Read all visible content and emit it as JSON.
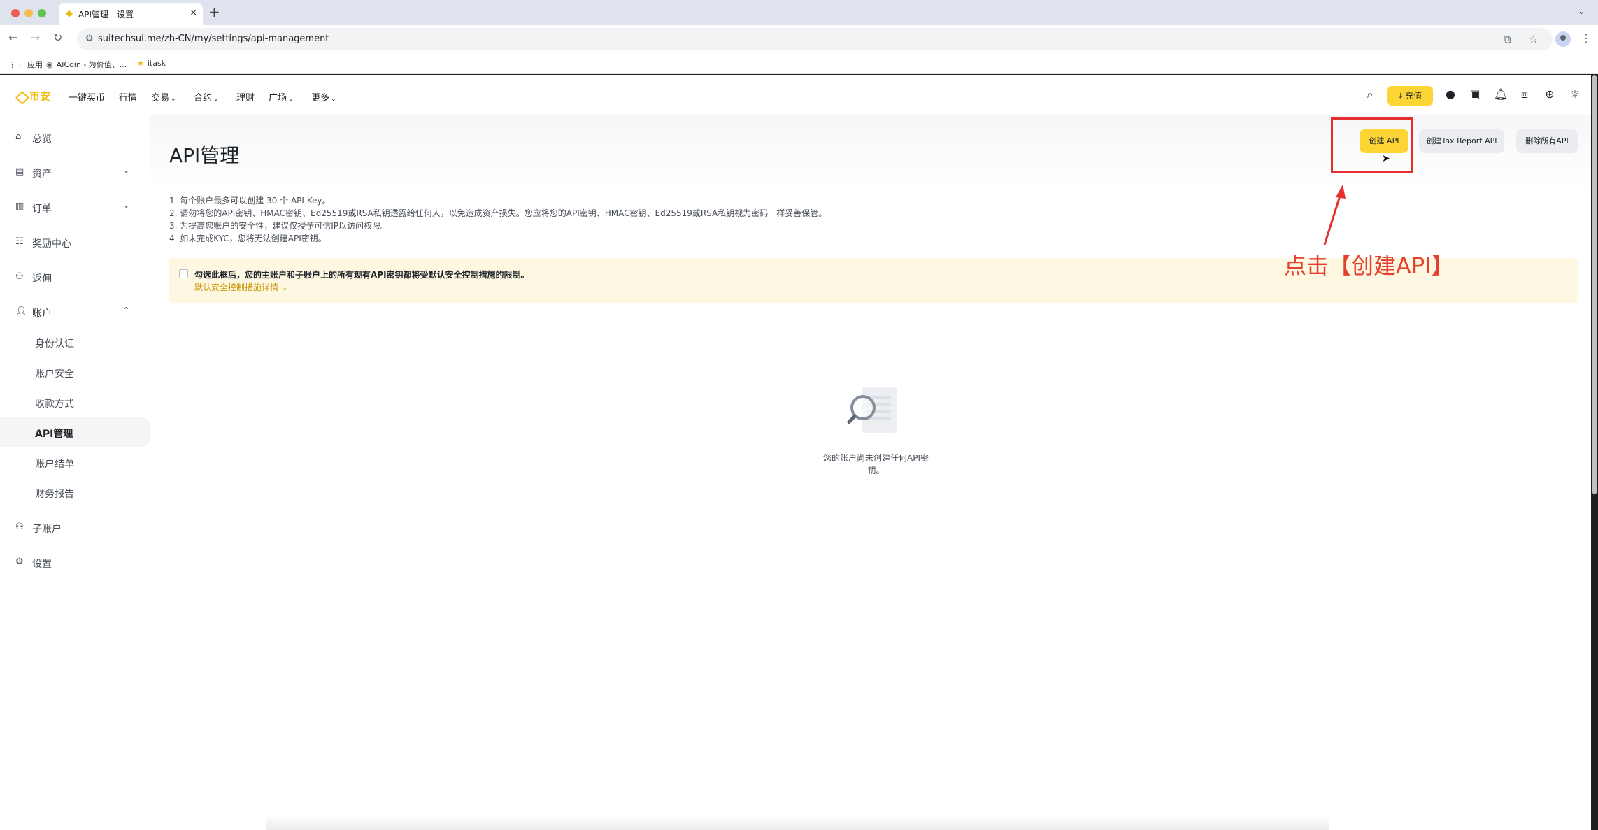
{
  "browser": {
    "tab_title": "API管理 - 设置",
    "tab_close": "×",
    "new_tab": "+",
    "tab_menu": "⌄",
    "url": "suitechsui.me/zh-CN/my/settings/api-management",
    "bookmarks": [
      {
        "label": "应用",
        "icon": "apps-grid-icon"
      },
      {
        "label": "AICoin - 为价值、...",
        "icon": "aicoin-icon"
      },
      {
        "label": "itask",
        "icon": "star-icon"
      }
    ]
  },
  "topnav": {
    "logo": "币安",
    "items": [
      {
        "label": "一键买币"
      },
      {
        "label": "行情"
      },
      {
        "label": "交易",
        "caret": true
      },
      {
        "label": "合约",
        "caret": true
      },
      {
        "label": "理财"
      },
      {
        "label": "广场",
        "caret": true
      },
      {
        "label": "更多",
        "caret": true
      }
    ],
    "deposit": "充值",
    "colors": {
      "brand": "#f0b90b",
      "button": "#fcd535"
    }
  },
  "sidebar": {
    "items": [
      {
        "label": "总览",
        "icon": "home-icon"
      },
      {
        "label": "资产",
        "icon": "wallet-icon",
        "expand": "down"
      },
      {
        "label": "订单",
        "icon": "orders-icon",
        "expand": "down"
      },
      {
        "label": "奖励中心",
        "icon": "rewards-icon"
      },
      {
        "label": "返佣",
        "icon": "referral-icon"
      },
      {
        "label": "账户",
        "icon": "user-icon",
        "expand": "up",
        "active_parent": true
      }
    ],
    "sub_items": [
      {
        "label": "身份认证"
      },
      {
        "label": "账户安全"
      },
      {
        "label": "收款方式"
      },
      {
        "label": "API管理",
        "active": true
      },
      {
        "label": "账户结单"
      },
      {
        "label": "财务报告"
      }
    ],
    "bottom_items": [
      {
        "label": "子账户",
        "icon": "sub-account-icon"
      },
      {
        "label": "设置",
        "icon": "gear-icon"
      }
    ]
  },
  "main": {
    "title": "API管理",
    "buttons": {
      "create_api": "创建 API",
      "create_tax_api": "创建Tax Report API",
      "delete_all": "删除所有API"
    },
    "notes": [
      "1. 每个账户最多可以创建 30 个 API Key。",
      "2. 请勿将您的API密钥、HMAC密钥、Ed25519或RSA私钥透露给任何人，以免造成资产损失。您应将您的API密钥、HMAC密钥、Ed25519或RSA私钥视为密码一样妥善保管。",
      "3. 为提高您账户的安全性，建议仅授予可信IP以访问权限。",
      "4. 如未完成KYC，您将无法创建API密钥。"
    ],
    "banner": {
      "text": "勾选此框后，您的主账户和子账户上的所有现有API密钥都将受默认安全控制措施的限制。",
      "link": "默认安全控制措施详情"
    },
    "empty_state": "您的账户尚未创建任何API密钥。"
  },
  "annotation": {
    "text": "点击【创建API】",
    "color": "#e5402d"
  }
}
